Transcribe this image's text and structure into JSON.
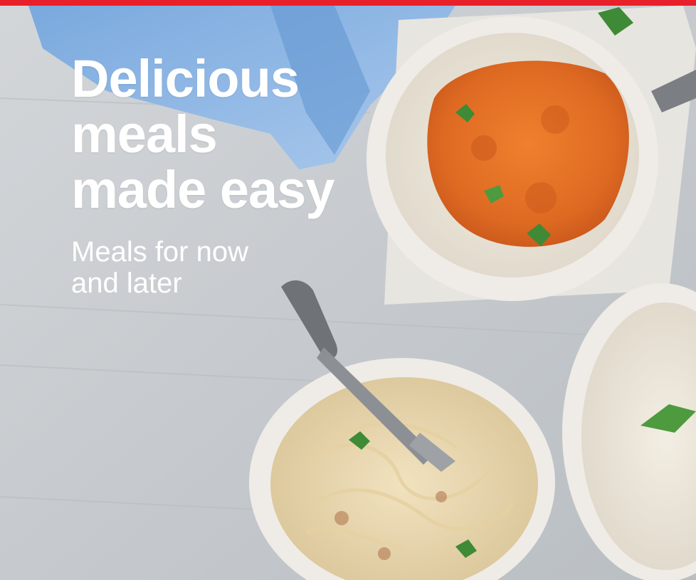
{
  "banner": {
    "headline_lines": [
      "Delicious",
      "meals",
      "made easy"
    ],
    "subline_lines": [
      "Meals for now",
      "and later"
    ]
  },
  "colors": {
    "accent_bar": "#e8202a",
    "text": "#ffffff"
  },
  "photo": {
    "subjects": [
      "curry-rice-bowl",
      "creamy-pasta-bowl",
      "rice-bowl",
      "fork",
      "blue-napkin",
      "cilantro"
    ]
  }
}
